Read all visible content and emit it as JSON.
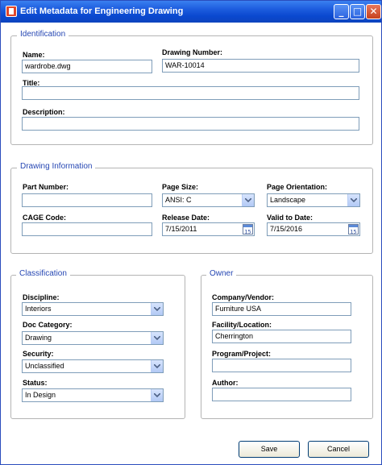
{
  "window": {
    "title": "Edit Metadata for Engineering Drawing",
    "icon": "app-document-icon",
    "controls": {
      "minimize": "_",
      "maximize": "□",
      "close": "✕"
    }
  },
  "identification": {
    "legend": "Identification",
    "name": {
      "label": "Name:",
      "value": "wardrobe.dwg"
    },
    "drawing_number": {
      "label": "Drawing Number:",
      "value": "WAR-10014"
    },
    "title": {
      "label": "Title:",
      "value": ""
    },
    "description": {
      "label": "Description:",
      "value": ""
    }
  },
  "drawing_info": {
    "legend": "Drawing Information",
    "part_number": {
      "label": "Part Number:",
      "value": ""
    },
    "page_size": {
      "label": "Page Size:",
      "value": "ANSI: C"
    },
    "page_orientation": {
      "label": "Page Orientation:",
      "value": "Landscape"
    },
    "cage_code": {
      "label": "CAGE Code:",
      "value": ""
    },
    "release_date": {
      "label": "Release Date:",
      "value": "7/15/2011",
      "cal_day": "15"
    },
    "valid_to_date": {
      "label": "Valid to Date:",
      "value": "7/15/2016",
      "cal_day": "15"
    }
  },
  "classification": {
    "legend": "Classification",
    "discipline": {
      "label": "Discipline:",
      "value": "Interiors"
    },
    "doc_category": {
      "label": "Doc Category:",
      "value": "Drawing"
    },
    "security": {
      "label": "Security:",
      "value": "Unclassified"
    },
    "status": {
      "label": "Status:",
      "value": "In Design"
    }
  },
  "owner": {
    "legend": "Owner",
    "company": {
      "label": "Company/Vendor:",
      "value": "Furniture USA"
    },
    "facility": {
      "label": "Facility/Location:",
      "value": "Cherrington"
    },
    "program": {
      "label": "Program/Project:",
      "value": ""
    },
    "author": {
      "label": "Author:",
      "value": ""
    }
  },
  "buttons": {
    "save": "Save",
    "cancel": "Cancel"
  },
  "colors": {
    "titlebar": "#0a48cf",
    "legend_text": "#2647b3",
    "field_border": "#7f9db9"
  }
}
